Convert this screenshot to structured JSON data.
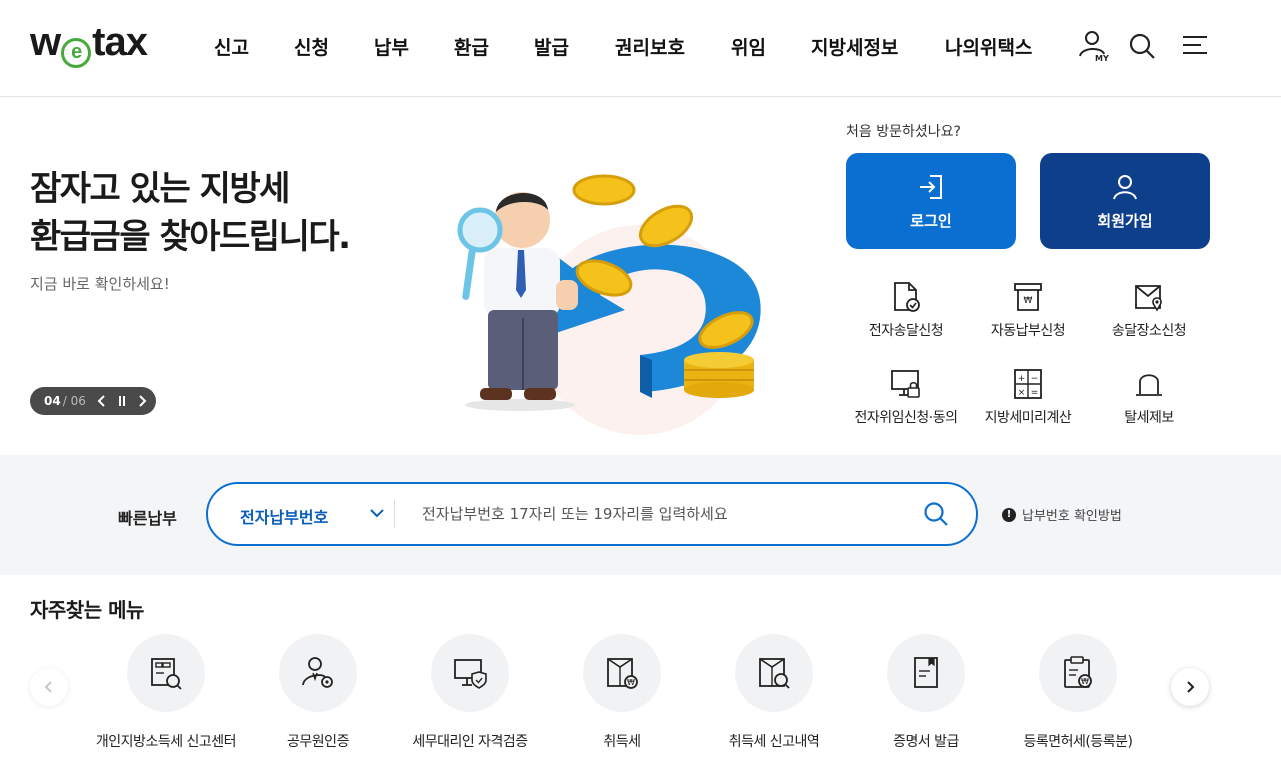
{
  "header": {
    "logo_left": "w",
    "logo_mid": "e",
    "logo_right": "tax",
    "nav": [
      "신고",
      "신청",
      "납부",
      "환급",
      "발급",
      "권리보호",
      "위임",
      "지방세정보",
      "나의위택스"
    ],
    "my_icon_label": "MY",
    "icons": [
      "my-page-icon",
      "search-icon",
      "menu-icon"
    ]
  },
  "hero": {
    "title_line1": "잠자고 있는 지방세",
    "title_line2": "환급금을 찾아드립니다.",
    "subtitle": "지금 바로 확인하세요!",
    "slide_current": "04",
    "slide_total": "06"
  },
  "account": {
    "question": "처음 방문하셨나요?",
    "login_label": "로그인",
    "join_label": "회원가입"
  },
  "quick_services": [
    {
      "label": "전자송달신청",
      "icon": "document-check-icon"
    },
    {
      "label": "자동납부신청",
      "icon": "auto-pay-icon"
    },
    {
      "label": "송달장소신청",
      "icon": "envelope-location-icon"
    },
    {
      "label": "전자위임신청·동의",
      "icon": "monitor-lock-icon"
    },
    {
      "label": "지방세미리계산",
      "icon": "calculator-icon"
    },
    {
      "label": "탈세제보",
      "icon": "siren-icon"
    }
  ],
  "fast_pay": {
    "title": "빠른납부",
    "select_value": "전자납부번호",
    "placeholder": "전자납부번호 17자리 또는 19자리를 입력하세요",
    "help_label": "납부번호 확인방법"
  },
  "frequent": {
    "title": "자주찾는 메뉴",
    "items": [
      {
        "label": "개인지방소득세 신고센터",
        "icon": "tax-report-search-icon"
      },
      {
        "label": "공무원인증",
        "icon": "official-gear-icon"
      },
      {
        "label": "세무대리인 자격검증",
        "icon": "monitor-shield-icon"
      },
      {
        "label": "취득세",
        "icon": "acquisition-tax-icon"
      },
      {
        "label": "취득세 신고내역",
        "icon": "tax-history-search-icon"
      },
      {
        "label": "증명서 발급",
        "icon": "certificate-icon"
      },
      {
        "label": "등록면허세(등록분)",
        "icon": "clipboard-won-icon"
      }
    ]
  },
  "colors": {
    "primary": "#0b6fd1",
    "navy": "#0e3f8b",
    "logo_green": "#47a83b",
    "band_bg": "#f4f5f7"
  }
}
